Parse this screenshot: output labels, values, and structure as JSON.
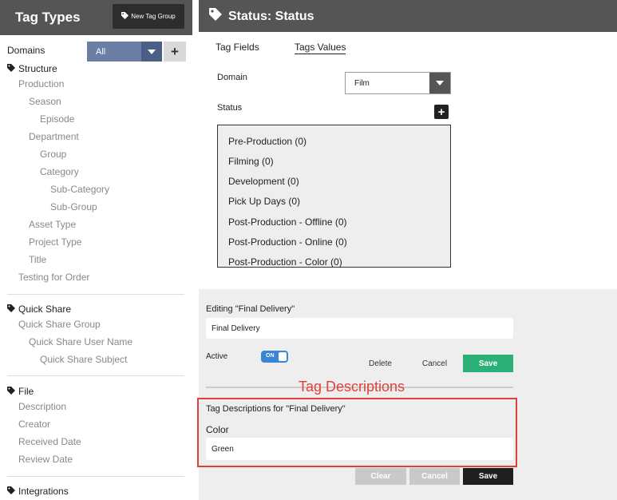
{
  "sidebar": {
    "title": "Tag Types",
    "new_tag_group_label": "New Tag Group",
    "domains_label": "Domains",
    "domains_value": "All",
    "domains_add": "+",
    "groups": {
      "structure": {
        "title": "Structure",
        "items": [
          "Production",
          "Season",
          "Episode",
          "Department",
          "Group",
          "Category",
          "Sub-Category",
          "Sub-Group",
          "Asset Type",
          "Project Type",
          "Title",
          "Testing for Order"
        ]
      },
      "quick_share": {
        "title": "Quick Share",
        "items": [
          "Quick Share Group",
          "Quick Share User Name",
          "Quick Share Subject"
        ]
      },
      "file": {
        "title": "File",
        "items": [
          "Description",
          "Creator",
          "Received Date",
          "Review Date"
        ]
      },
      "integrations": {
        "title": "Integrations"
      }
    }
  },
  "main": {
    "title": "Status: Status",
    "tabs": {
      "fields": "Tag Fields",
      "values": "Tags Values"
    },
    "domain_label": "Domain",
    "domain_value": "Film",
    "status_label": "Status",
    "status_add": "+",
    "status_items": [
      "Pre-Production (0)",
      "Filming (0)",
      "Development (0)",
      "Pick Up Days (0)",
      "Post-Production - Offline (0)",
      "Post-Production - Online (0)",
      "Post-Production - Color (0)"
    ]
  },
  "editor": {
    "editing_label": "Editing \"Final Delivery\"",
    "editing_value": "Final Delivery",
    "active_label": "Active",
    "active_toggle": "ON",
    "delete_label": "Delete",
    "cancel_label": "Cancel",
    "save_label": "Save",
    "annotation": "Tag Descriptions",
    "desc_title": "Tag Descriptions for \"Final Delivery\"",
    "color_label": "Color",
    "color_value": "Green",
    "clear_label": "Clear",
    "cancel2_label": "Cancel",
    "save2_label": "Save"
  },
  "colors": {
    "header_bg": "#555555",
    "save_green": "#2bb078",
    "annotation_red": "#e0403a",
    "domains_blue": "#6b7fa6"
  }
}
